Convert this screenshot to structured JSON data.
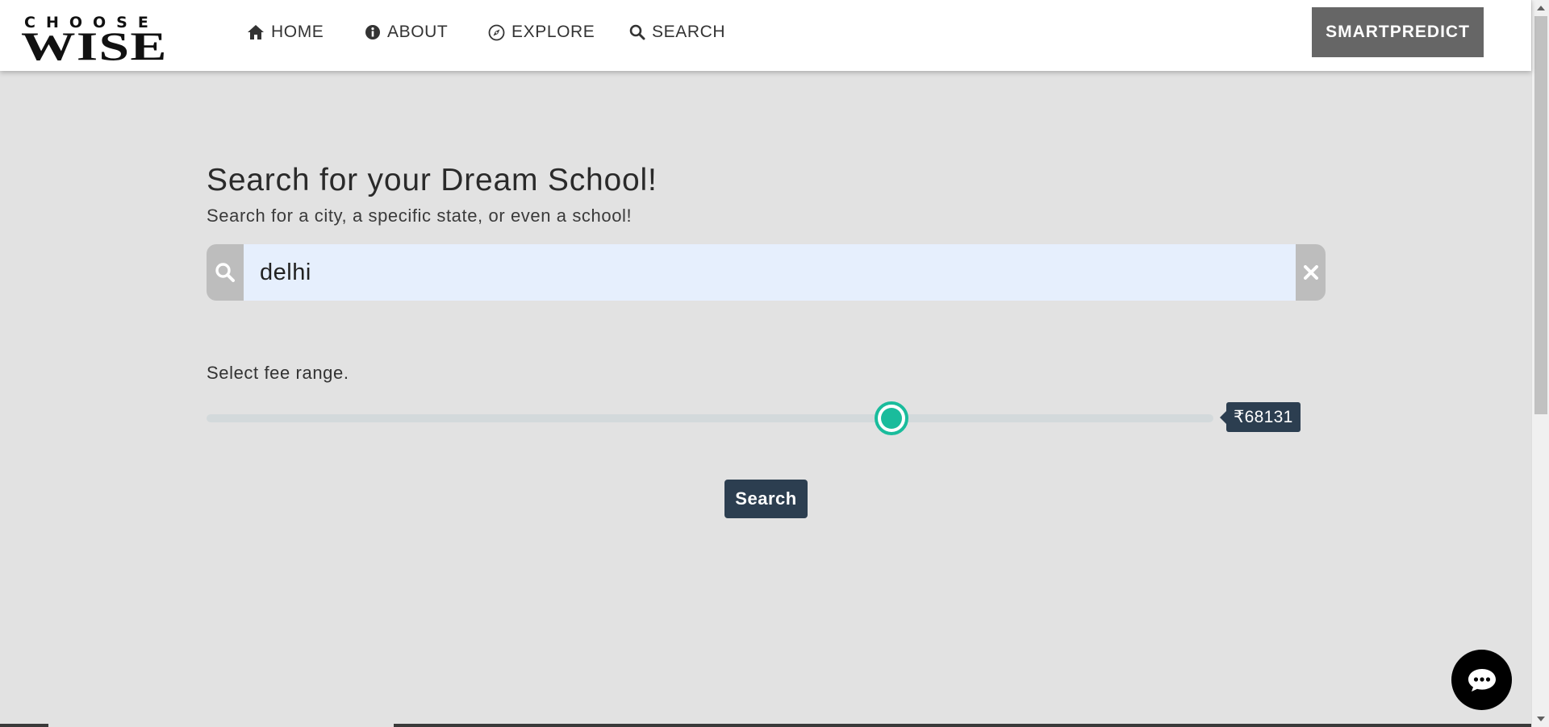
{
  "logo": {
    "top_text": "CHOOSE",
    "bottom_text": "WISE"
  },
  "nav": {
    "items": [
      {
        "label": "HOME",
        "icon": "home-icon"
      },
      {
        "label": "ABOUT",
        "icon": "info-icon"
      },
      {
        "label": "EXPLORE",
        "icon": "compass-icon"
      },
      {
        "label": "SEARCH",
        "icon": "search-icon"
      }
    ],
    "cta_label": "SMARTPREDICT"
  },
  "main": {
    "heading": "Search for your Dream School!",
    "subheading": "Search for a city, a specific state, or even a school!",
    "search_value": "delhi",
    "fee_label": "Select fee range.",
    "slider": {
      "value_label": "₹68131",
      "fraction": 0.68
    },
    "search_button_label": "Search"
  },
  "colors": {
    "accent": "#1abc9c",
    "dark": "#2c3e50",
    "cta": "#666666",
    "input_bg": "#e6effd",
    "page_bg": "#e2e2e2"
  },
  "icons": {
    "search_box_left": "search-icon",
    "search_box_right": "close-icon",
    "chat": "chat-icon"
  }
}
